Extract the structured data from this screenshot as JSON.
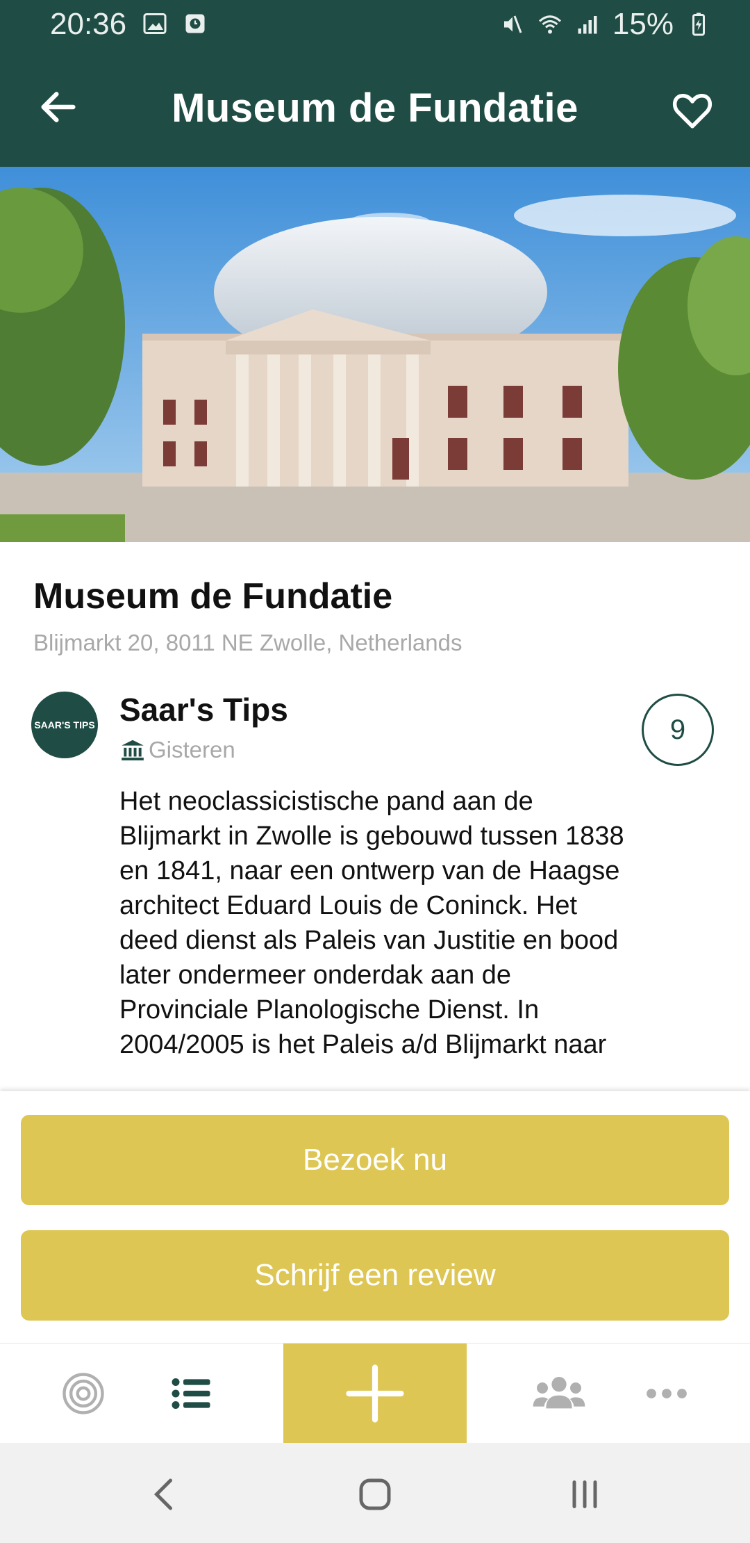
{
  "status_bar": {
    "time": "20:36",
    "battery": "15%",
    "icons": [
      "image-icon",
      "clock-app-icon",
      "mute-icon",
      "wifi-icon",
      "signal-icon",
      "battery-charging-icon"
    ]
  },
  "app_bar": {
    "title": "Museum de Fundatie",
    "back_icon": "arrow-left-icon",
    "favorite_icon": "heart-outline-icon"
  },
  "place": {
    "name": "Museum de Fundatie",
    "address": "Blijmarkt 20, 8011 NE Zwolle, Netherlands"
  },
  "review": {
    "author": "Saar's Tips",
    "avatar_text": "SAAR'S TIPS",
    "category_icon": "museum-icon",
    "time": "Gisteren",
    "score": "9",
    "text": "Het neoclassicistische pand aan de Blijmarkt in Zwolle is gebouwd tussen 1838 en 1841, naar een ontwerp van de Haagse architect Eduard Louis de Coninck. Het deed dienst als Paleis van Justitie en bood later ondermeer onderdak aan de Provinciale Planologische Dienst. In 2004/2005 is het Paleis a/d Blijmarkt naar"
  },
  "actions": {
    "visit_label": "Bezoek nu",
    "write_review_label": "Schrijf een review"
  },
  "bottom_nav": {
    "items": [
      "radar-icon",
      "list-icon",
      "plus-icon",
      "community-icon",
      "more-icon"
    ],
    "accent": "#ddc653",
    "primary": "#1f4d45"
  }
}
